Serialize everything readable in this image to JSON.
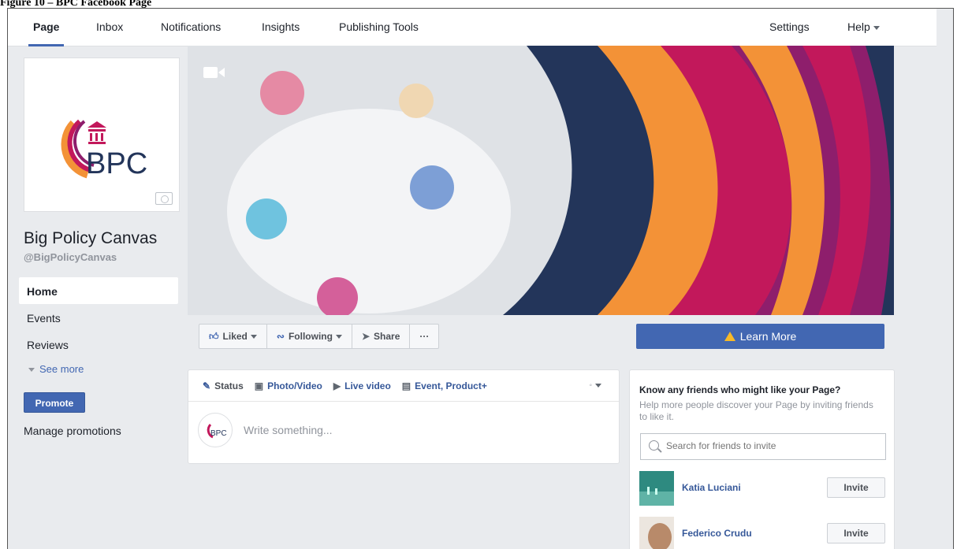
{
  "caption": "Figure 10 – BPC Facebook Page",
  "topnav": {
    "tabs": [
      "Page",
      "Inbox",
      "Notifications",
      "Insights",
      "Publishing Tools"
    ],
    "settings": "Settings",
    "help": "Help"
  },
  "profile": {
    "logo_text": "BPC",
    "name": "Big Policy Canvas",
    "handle": "@BigPolicyCanvas"
  },
  "sidenav": {
    "items": [
      "Home",
      "Events",
      "Reviews"
    ],
    "see_more": "See more",
    "promote": "Promote",
    "manage_promotions": "Manage promotions"
  },
  "actions": {
    "liked": "Liked",
    "following": "Following",
    "share": "Share",
    "more": "···",
    "learn_more": "Learn More"
  },
  "composer": {
    "tabs": [
      "Status",
      "Photo/Video",
      "Live video",
      "Event, Product+"
    ],
    "placeholder": "Write something..."
  },
  "invite": {
    "title": "Know any friends who might like your Page?",
    "description": "Help more people discover your Page by inviting friends to like it.",
    "search_placeholder": "Search for friends to invite",
    "friends": [
      {
        "name": "Katia Luciani",
        "button": "Invite"
      },
      {
        "name": "Federico Crudu",
        "button": "Invite"
      }
    ]
  },
  "colors": {
    "brand_blue": "#4267b2",
    "navy": "#23355a",
    "orange": "#f39237",
    "magenta": "#c2185b",
    "purple": "#8e1e6c"
  }
}
